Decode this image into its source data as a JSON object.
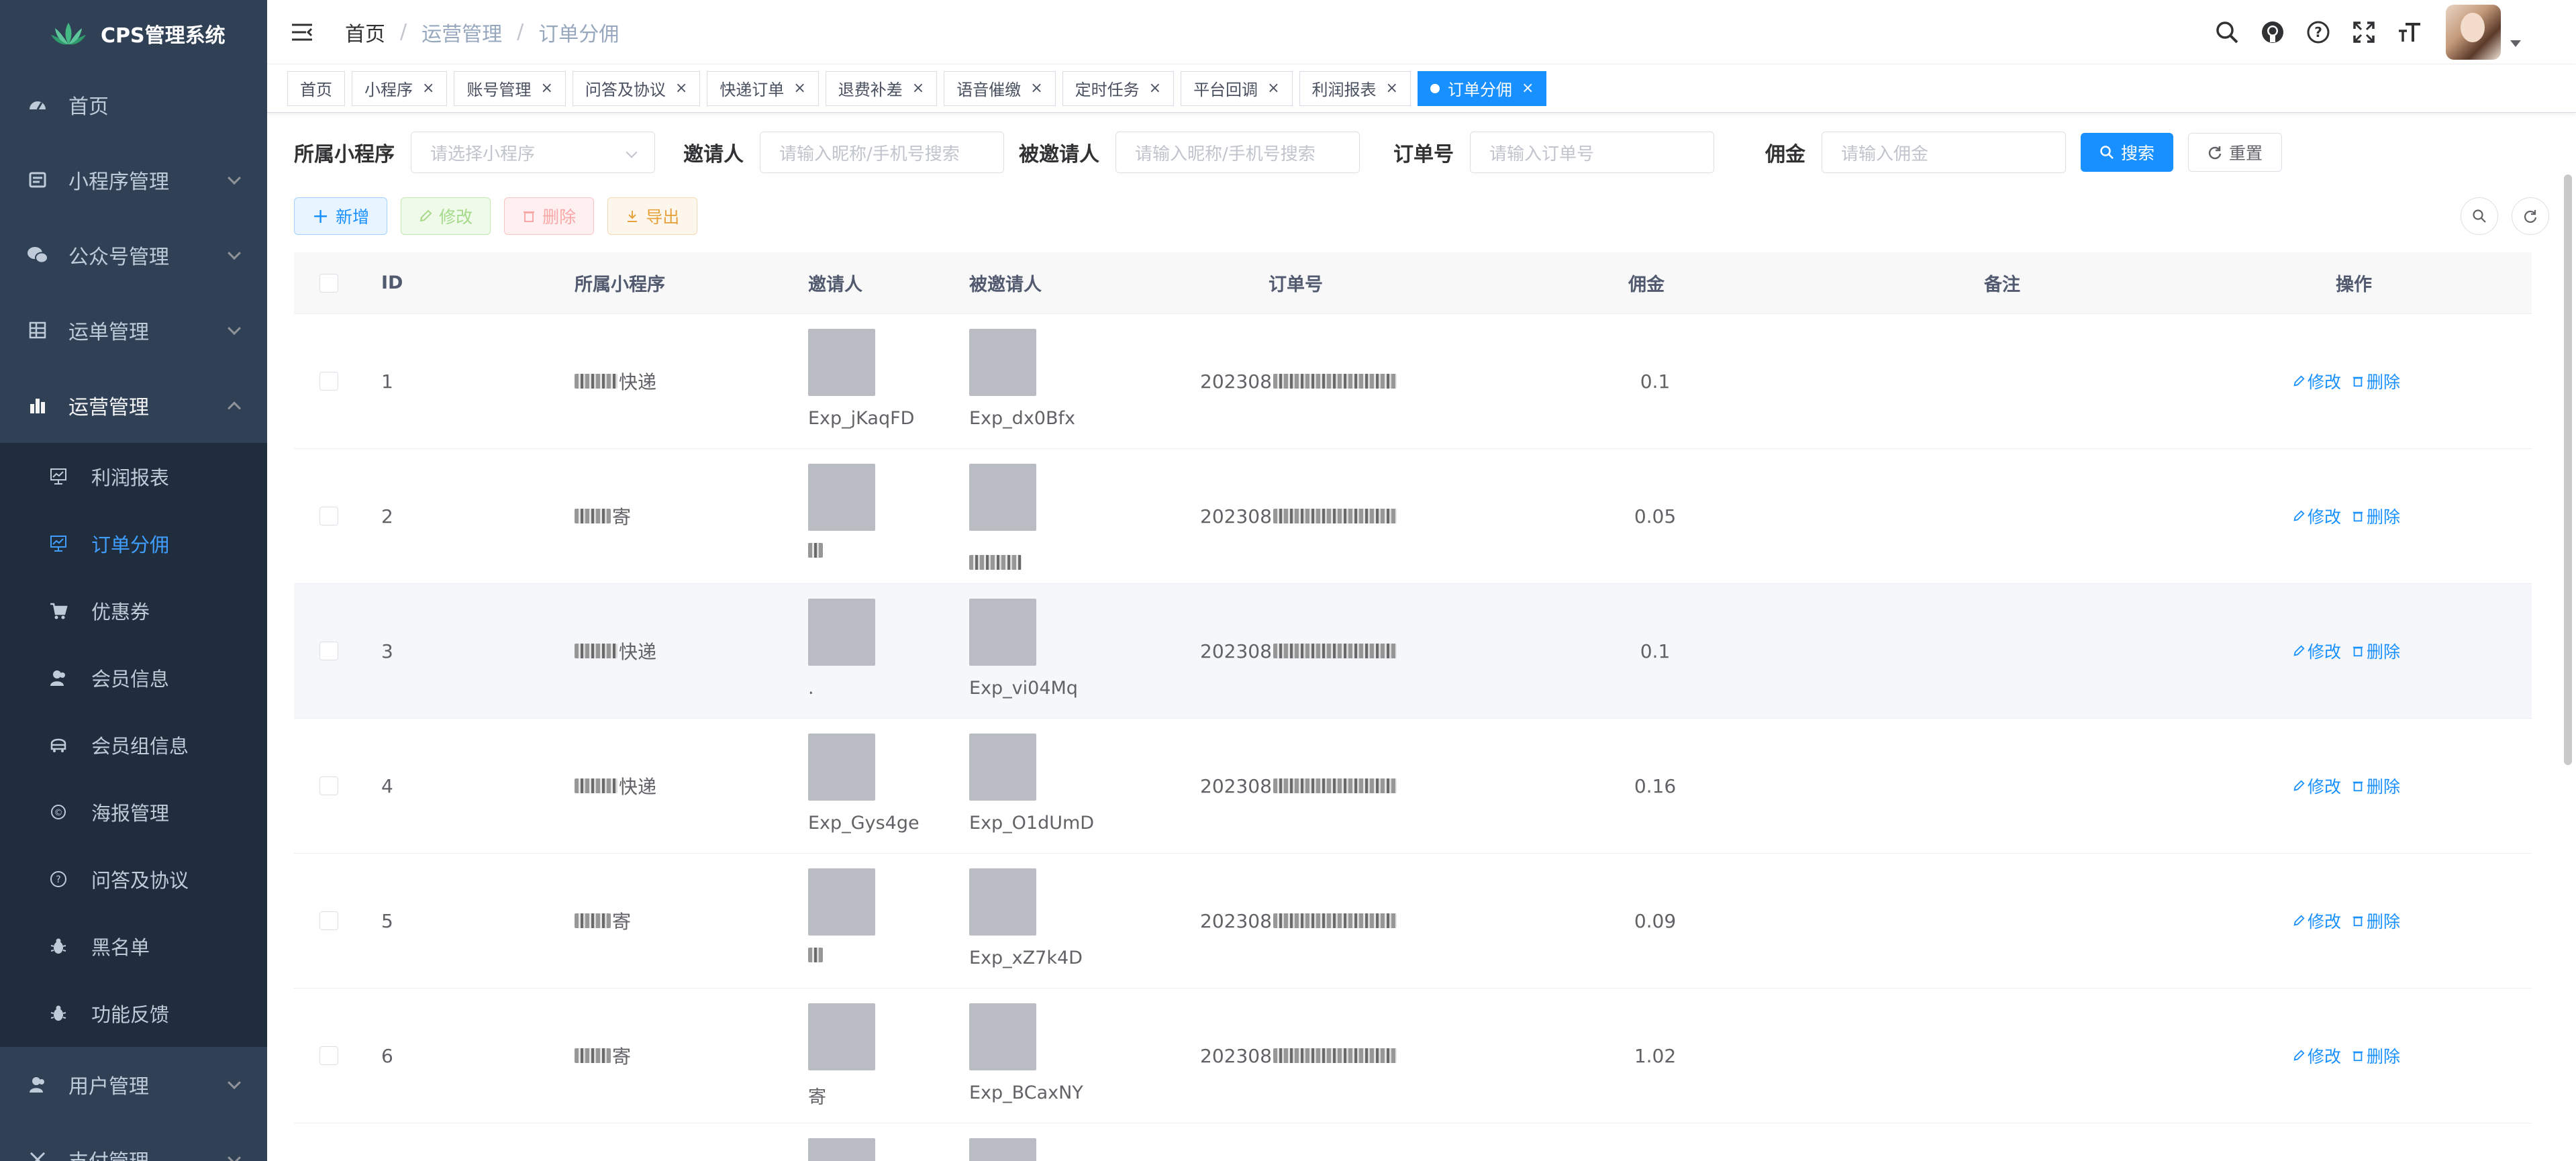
{
  "app": {
    "name": "CPS管理系统"
  },
  "sidebar": {
    "items": [
      {
        "label": "首页",
        "icon": "dashboard-icon",
        "arrow": false
      },
      {
        "label": "小程序管理",
        "icon": "miniprogram-icon",
        "arrow": true
      },
      {
        "label": "公众号管理",
        "icon": "wechat-icon",
        "arrow": true
      },
      {
        "label": "运单管理",
        "icon": "grid-icon",
        "arrow": true
      },
      {
        "label": "运营管理",
        "icon": "chart-icon",
        "arrow": true,
        "open": true
      }
    ],
    "sub_items": [
      {
        "label": "利润报表",
        "icon": "report-icon"
      },
      {
        "label": "订单分佣",
        "icon": "order-commission-icon",
        "active": true
      },
      {
        "label": "优惠券",
        "icon": "cart-icon"
      },
      {
        "label": "会员信息",
        "icon": "member-icon"
      },
      {
        "label": "会员组信息",
        "icon": "member-group-icon"
      },
      {
        "label": "海报管理",
        "icon": "poster-icon"
      },
      {
        "label": "问答及协议",
        "icon": "question-icon"
      },
      {
        "label": "黑名单",
        "icon": "bug-icon"
      },
      {
        "label": "功能反馈",
        "icon": "bug-icon"
      }
    ],
    "bottom_items": [
      {
        "label": "用户管理",
        "icon": "user-icon"
      },
      {
        "label": "支付管理",
        "icon": "pay-icon"
      }
    ]
  },
  "breadcrumb": [
    "首页",
    "运营管理",
    "订单分佣"
  ],
  "tags": [
    {
      "label": "首页",
      "closable": false
    },
    {
      "label": "小程序",
      "closable": true
    },
    {
      "label": "账号管理",
      "closable": true
    },
    {
      "label": "问答及协议",
      "closable": true
    },
    {
      "label": "快递订单",
      "closable": true
    },
    {
      "label": "退费补差",
      "closable": true
    },
    {
      "label": "语音催缴",
      "closable": true
    },
    {
      "label": "定时任务",
      "closable": true
    },
    {
      "label": "平台回调",
      "closable": true
    },
    {
      "label": "利润报表",
      "closable": true
    },
    {
      "label": "订单分佣",
      "closable": true,
      "active": true
    }
  ],
  "filters": {
    "miniprogram": {
      "label": "所属小程序",
      "placeholder": "请选择小程序"
    },
    "inviter": {
      "label": "邀请人",
      "placeholder": "请输入昵称/手机号搜索"
    },
    "invitee": {
      "label": "被邀请人",
      "placeholder": "请输入昵称/手机号搜索"
    },
    "order_no": {
      "label": "订单号",
      "placeholder": "请输入订单号"
    },
    "commission": {
      "label": "佣金",
      "placeholder": "请输入佣金"
    },
    "search_label": "搜索",
    "reset_label": "重置"
  },
  "toolbar": {
    "add": "新增",
    "edit": "修改",
    "delete": "删除",
    "export": "导出"
  },
  "table": {
    "headers": {
      "id": "ID",
      "miniprogram": "所属小程序",
      "inviter": "邀请人",
      "invitee": "被邀请人",
      "order_no": "订单号",
      "commission": "佣金",
      "remark": "备注",
      "ops": "操作"
    },
    "rows": [
      {
        "id": "1",
        "mp": "快递",
        "inviter": "Exp_jKaqFD",
        "invitee": "Exp_dx0Bfx",
        "order": "202308",
        "commission": "0.1"
      },
      {
        "id": "2",
        "mp": "寄",
        "inviter": "",
        "invitee": "",
        "order": "202308",
        "commission": "0.05"
      },
      {
        "id": "3",
        "mp": "快递",
        "inviter": ".",
        "invitee": "Exp_vi04Mq",
        "order": "202308",
        "commission": "0.1"
      },
      {
        "id": "4",
        "mp": "快递",
        "inviter": "Exp_Gys4ge",
        "invitee": "Exp_O1dUmD",
        "order": "202308",
        "commission": "0.16"
      },
      {
        "id": "5",
        "mp": "寄",
        "inviter": "",
        "invitee": "Exp_xZ7k4D",
        "order": "202308",
        "commission": "0.09"
      },
      {
        "id": "6",
        "mp": "寄",
        "inviter": "寄",
        "invitee": "Exp_BCaxNY",
        "order": "202308",
        "commission": "1.02"
      }
    ],
    "op_edit": "修改",
    "op_delete": "删除"
  }
}
